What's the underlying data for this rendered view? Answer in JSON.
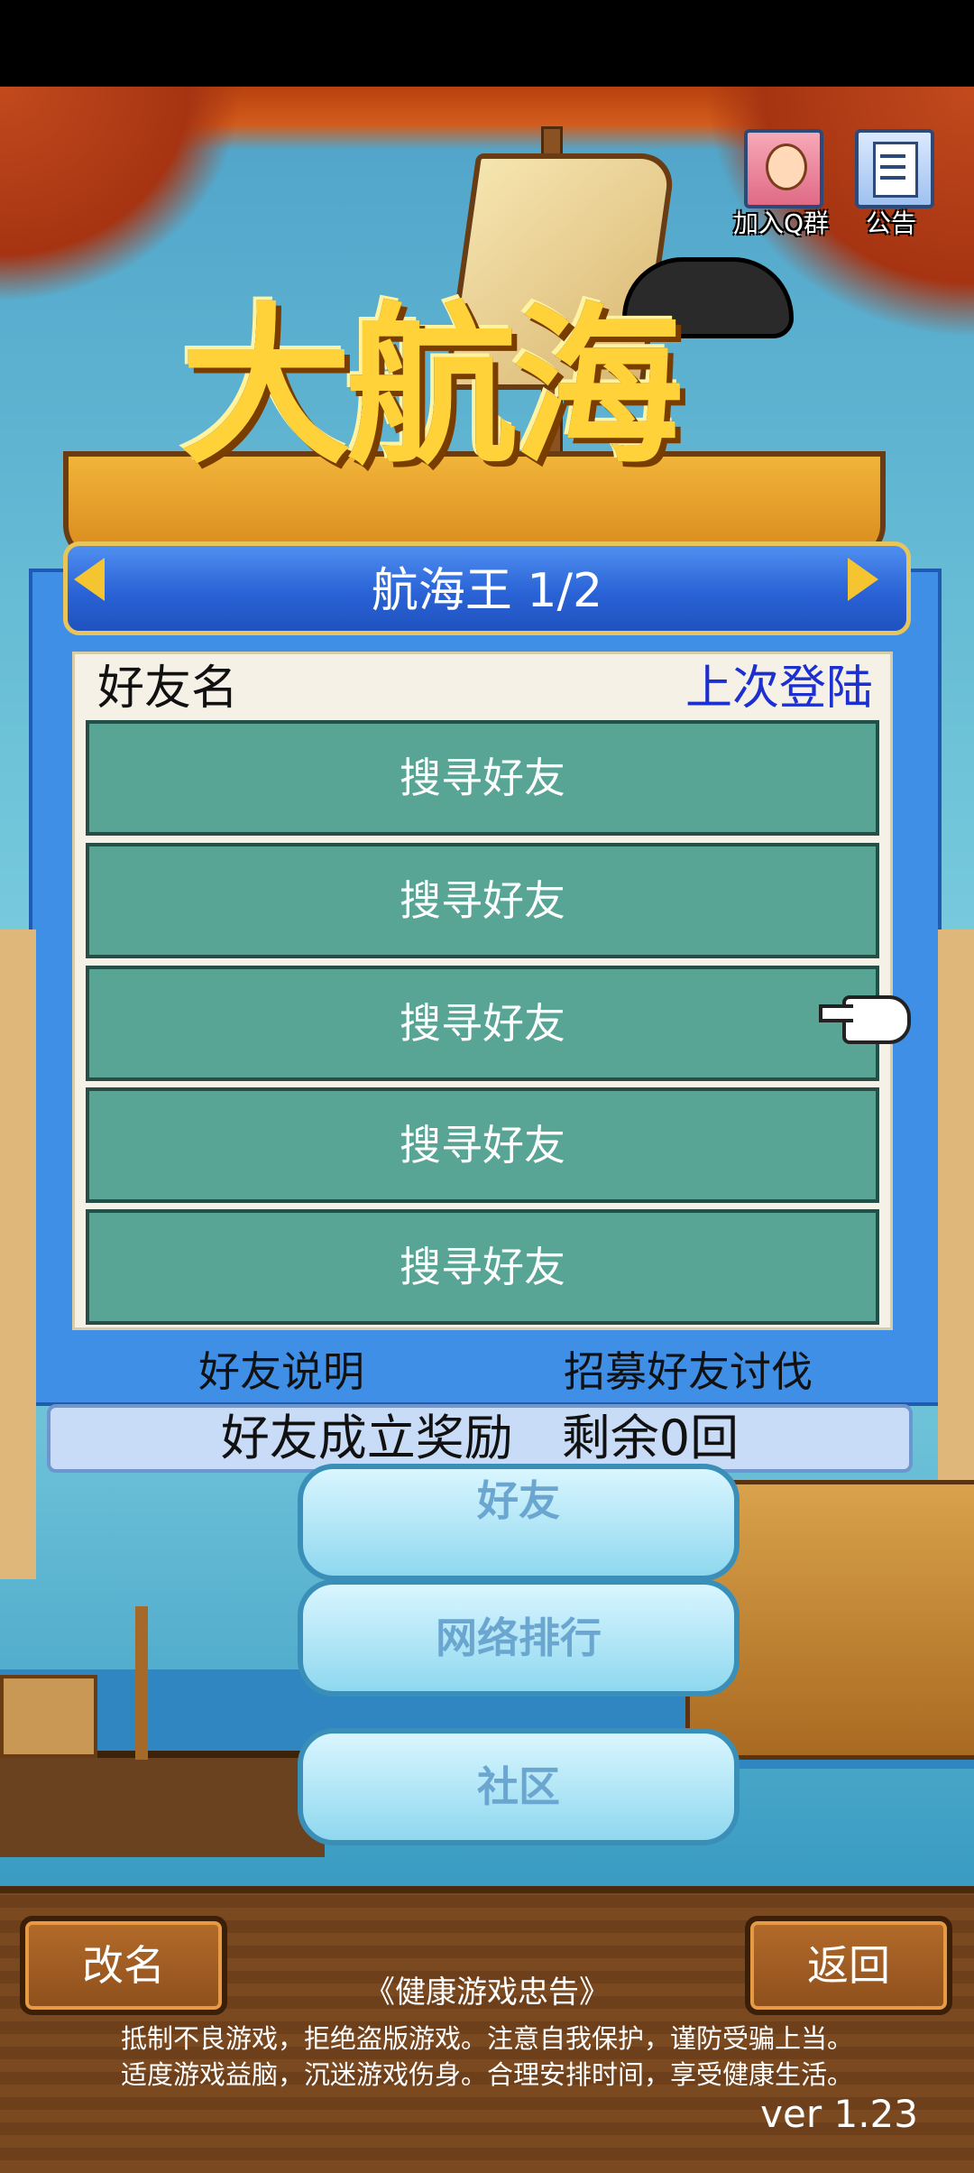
{
  "header_icons": {
    "join_group_label": "加入Q群",
    "notice_label": "公告"
  },
  "logo": {
    "title": "大航海"
  },
  "panel": {
    "title": "航海王 1/2",
    "column_name": "好友名",
    "column_last_login": "上次登陆",
    "rows": [
      "搜寻好友",
      "搜寻好友",
      "搜寻好友",
      "搜寻好友",
      "搜寻好友"
    ],
    "explain_link": "好友说明",
    "recruit_link": "招募好友讨伐"
  },
  "reward": {
    "text": "好友成立奖励　剩余0回"
  },
  "menu": {
    "friends": "好友",
    "ranking": "网络排行",
    "community": "社区"
  },
  "bottom": {
    "rename": "改名",
    "back": "返回",
    "health_title": "《健康游戏忠告》",
    "health_line1": "抵制不良游戏，拒绝盗版游戏。注意自我保护，谨防受骗上当。",
    "health_line2": "适度游戏益脑，沉迷游戏伤身。合理安排时间，享受健康生活。",
    "version": "ver 1.23"
  }
}
